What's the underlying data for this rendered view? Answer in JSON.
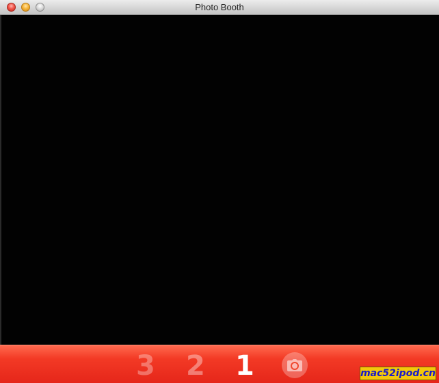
{
  "window": {
    "title": "Photo Booth"
  },
  "countdown": {
    "three": "3",
    "two": "2",
    "one": "1",
    "active": "1",
    "camera_icon": "camera-icon"
  },
  "watermark": {
    "text": "mac52ipod.cn"
  },
  "colors": {
    "countdown_bar": "#f33a25",
    "viewport": "#020202",
    "watermark_bg": "#f3c70b",
    "watermark_text": "#1a1ac9"
  }
}
